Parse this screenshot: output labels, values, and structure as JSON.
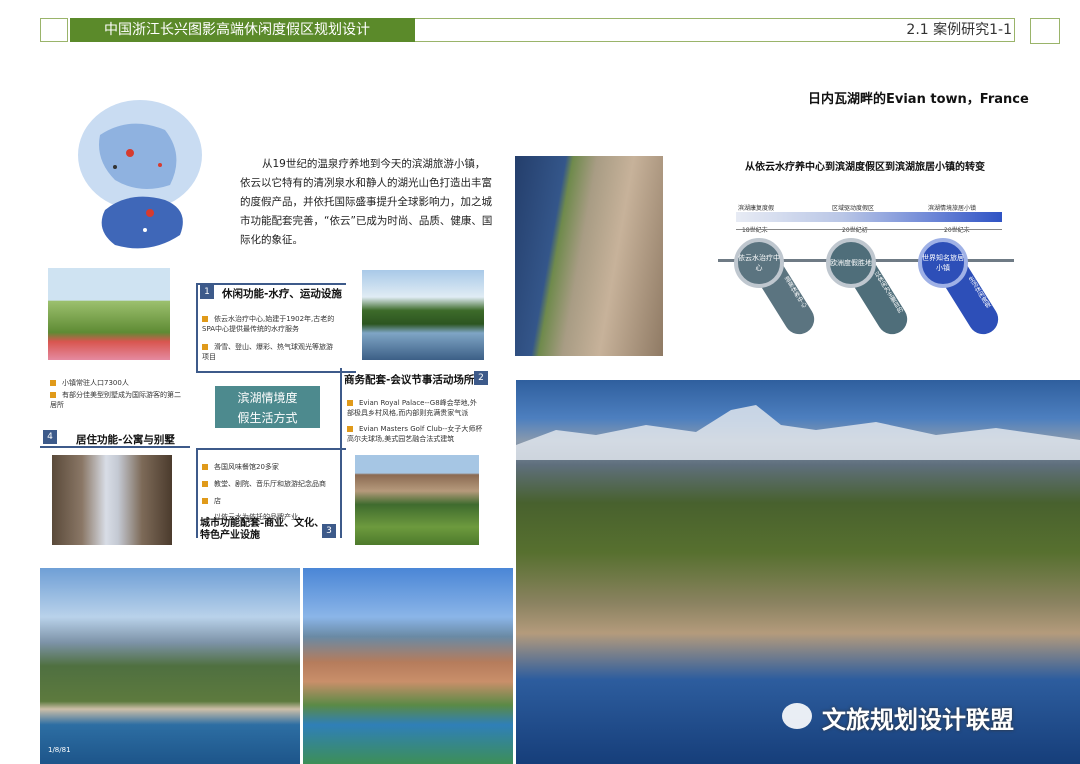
{
  "header": {
    "title": "中国浙江长兴图影高端休闲度假区规划设计",
    "section": "2.1   案例研究1-1"
  },
  "subtitle": "日内瓦湖畔的Evian town，France",
  "intro": "从19世纪的温泉疗养地到今天的滨湖旅游小镇，依云以它特有的清冽泉水和静人的湖光山色打造出丰富的度假产品，并依托国际盛事提升全球影响力，加之城市功能配套完善，“依云”已成为时尚、品质、健康、国际化的象征。",
  "center_label": [
    "滨湖情境度",
    "假生活方式"
  ],
  "sections": [
    {
      "num": "1",
      "title": "休闲功能-水疗、运动设施",
      "bullets": [
        "依云水治疗中心,始建于1902年,古老的SPA中心提供最传统的水疗服务",
        "滑雪、登山、爆彩、热气球观光等旅游项目"
      ]
    },
    {
      "num": "2",
      "title": "商务配套-会议节事活动场所",
      "bullets": [
        "Evian Royal Palace--G8峰会举地,外部极具乡村风格,而内部则充满贵家气派",
        "Evian Masters Golf Club--女子大师杯高尔夫球场,美式园艺融合法式建筑"
      ]
    },
    {
      "num": "3",
      "title": "城市功能配套-商业、文化、特色产业设施",
      "bullets": [
        "各国风味餐馆20多家",
        "教堂、剧院、音乐厅和旅游纪念品商",
        "店",
        "以依云水为依托的品牌产业"
      ]
    },
    {
      "num": "4",
      "title": "居住功能-公寓与别墅",
      "bullets": [
        "小镇常驻人口7300人",
        "有部分佳美型别墅成为国际游客的第二居所"
      ]
    }
  ],
  "timeline": {
    "title": "从依云水疗养中心到滨湖度假区到滨湖旅居小镇的转变",
    "bands": [
      "滨湖康复度假",
      "区域驱动度假区",
      "滨湖情境旅居小镇"
    ],
    "eras": [
      "18世纪末",
      "20世纪初",
      "20世纪末"
    ],
    "stages": [
      {
        "label": "依云水治疗中心",
        "tail": "温泉休养中心",
        "color": "#5b7480"
      },
      {
        "label": "欧洲度假胜地",
        "tail": "以休闲为主要目的",
        "color": "#4f6e7a"
      },
      {
        "label": "世界知名旅居小镇",
        "tail": "生活休闲度假",
        "color": "#2d4fb8"
      }
    ]
  },
  "photo_caption": "1/8/81",
  "watermark": "文旅规划设计联盟"
}
